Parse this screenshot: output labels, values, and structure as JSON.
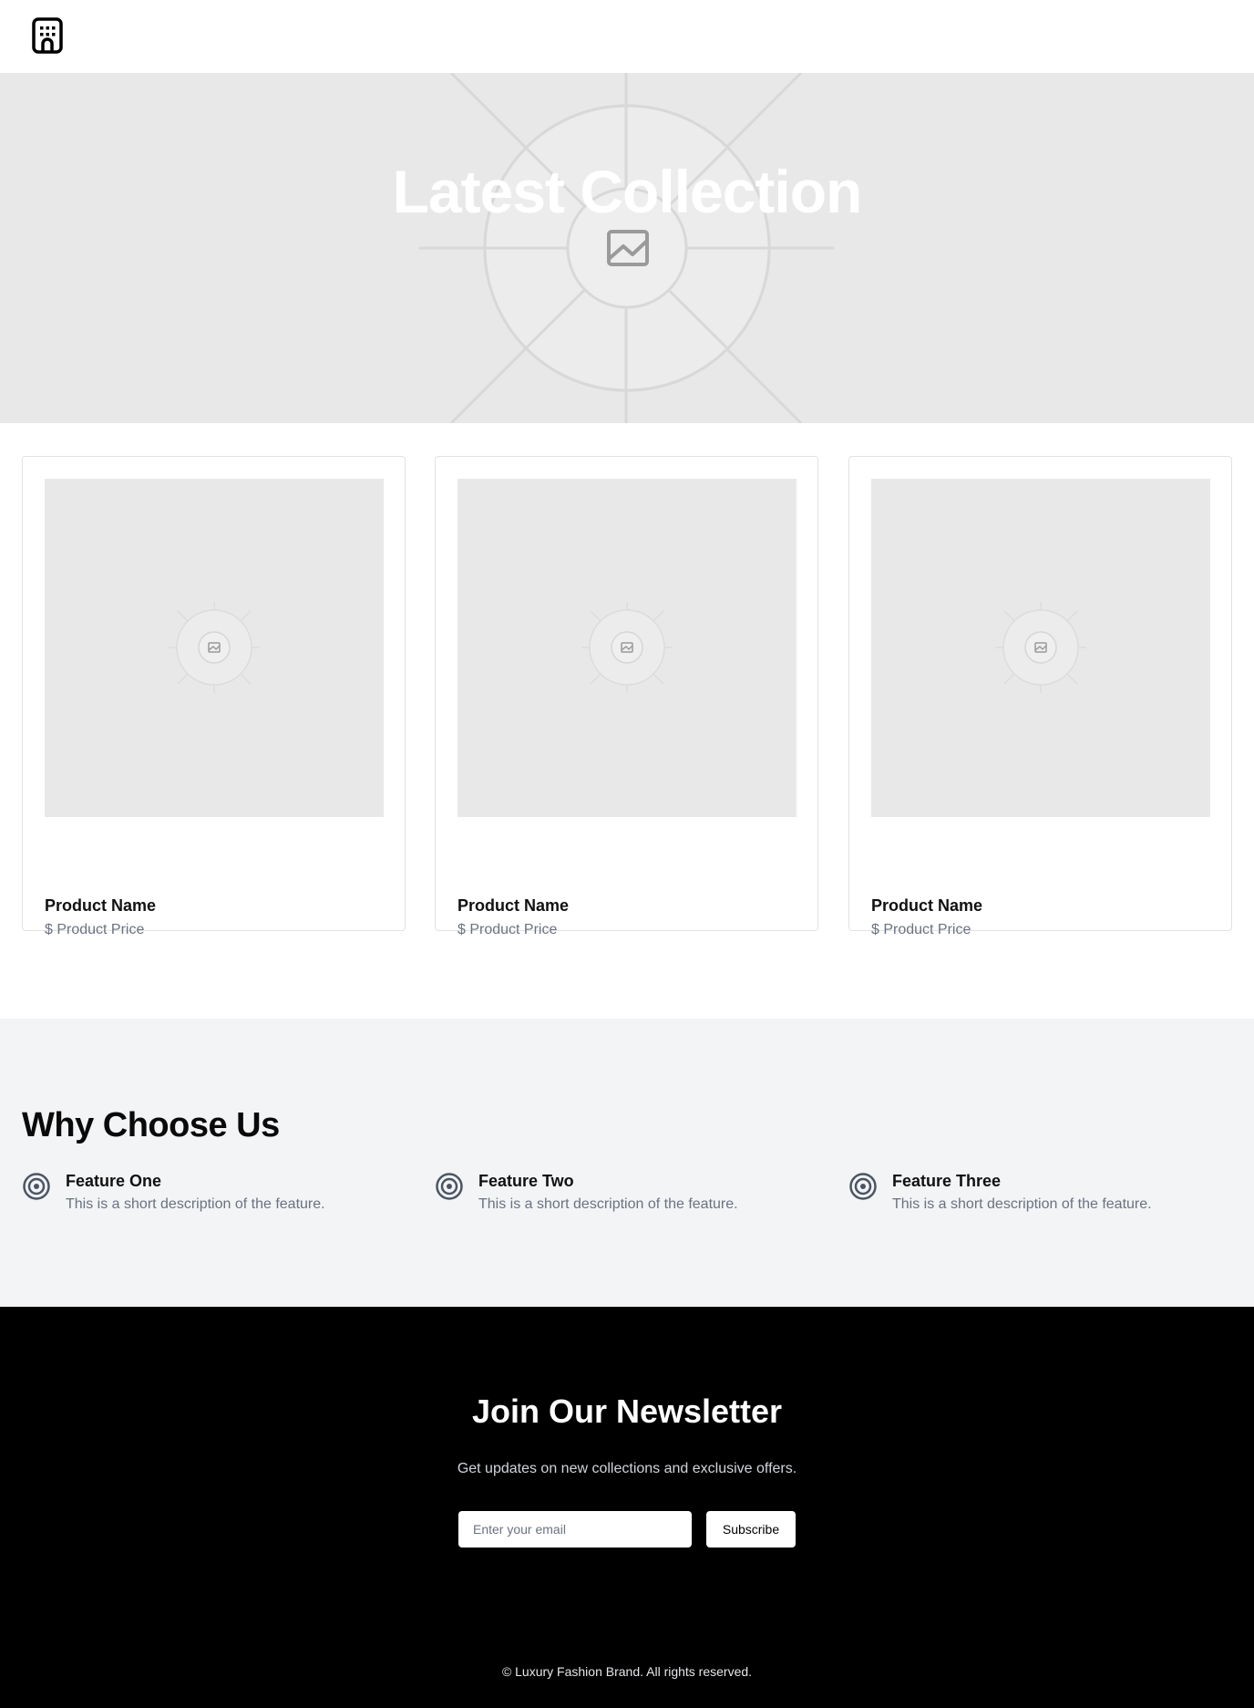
{
  "header": {
    "logo_icon": "building-icon"
  },
  "hero": {
    "title": "Latest Collection",
    "image_icon": "image-placeholder-icon",
    "background_color": "#e8e8e8"
  },
  "products": [
    {
      "name": "Product Name",
      "price": "$ Product Price",
      "image_icon": "image-placeholder-icon"
    },
    {
      "name": "Product Name",
      "price": "$ Product Price",
      "image_icon": "image-placeholder-icon"
    },
    {
      "name": "Product Name",
      "price": "$ Product Price",
      "image_icon": "image-placeholder-icon"
    }
  ],
  "features": {
    "title": "Why Choose Us",
    "items": [
      {
        "title": "Feature One",
        "description": "This is a short description of the feature.",
        "icon": "target-icon"
      },
      {
        "title": "Feature Two",
        "description": "This is a short description of the feature.",
        "icon": "target-icon"
      },
      {
        "title": "Feature Three",
        "description": "This is a short description of the feature.",
        "icon": "target-icon"
      }
    ]
  },
  "newsletter": {
    "title": "Join Our Newsletter",
    "subtitle": "Get updates on new collections and exclusive offers.",
    "email_placeholder": "Enter your email",
    "email_value": "",
    "subscribe_label": "Subscribe"
  },
  "footer": {
    "copyright": "© Luxury Fashion Brand. All rights reserved."
  },
  "colors": {
    "accent": "#000000",
    "muted_text": "#6b7280",
    "section_bg": "#f3f4f6"
  }
}
